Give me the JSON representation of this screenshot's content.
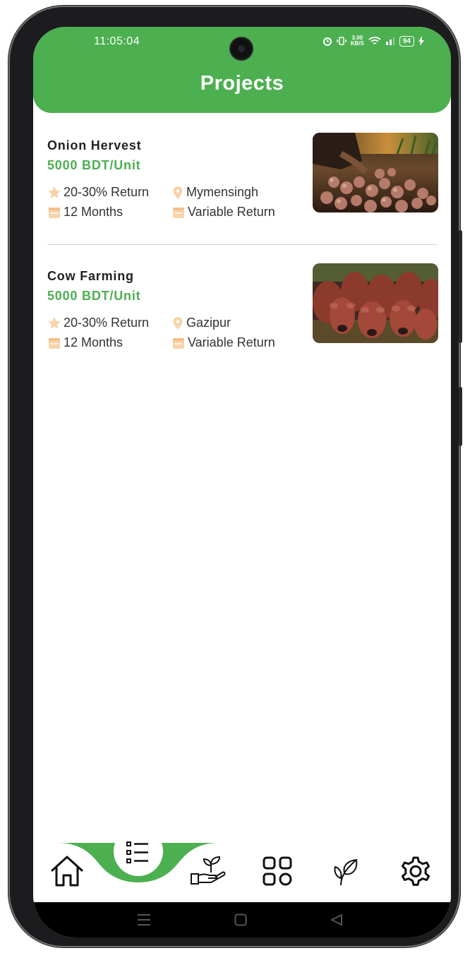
{
  "status_bar": {
    "time": "11:05:04",
    "net_speed": "3.00",
    "net_unit": "KB/S",
    "battery": "94"
  },
  "header": {
    "title": "Projects"
  },
  "colors": {
    "accent": "#4caf50",
    "icon_peach": "#f7d3ab"
  },
  "projects": [
    {
      "title": "Onion Hervest",
      "price": "5000 BDT/Unit",
      "return_rate": "20-30%  Return",
      "location": "Mymensingh",
      "duration": "12 Months",
      "return_type": "Variable Return"
    },
    {
      "title": "Cow Farming",
      "price": "5000 BDT/Unit",
      "return_rate": "20-30%  Return",
      "location": "Gazipur",
      "duration": "12 Months",
      "return_type": "Variable Return"
    }
  ],
  "bottom_nav": {
    "items": [
      "home-icon",
      "list-icon",
      "hand-plant-icon",
      "grid-icon",
      "leaf-icon",
      "gear-icon"
    ],
    "active": "list-icon"
  },
  "system_nav": [
    "menu-icon",
    "square-icon",
    "back-icon"
  ]
}
